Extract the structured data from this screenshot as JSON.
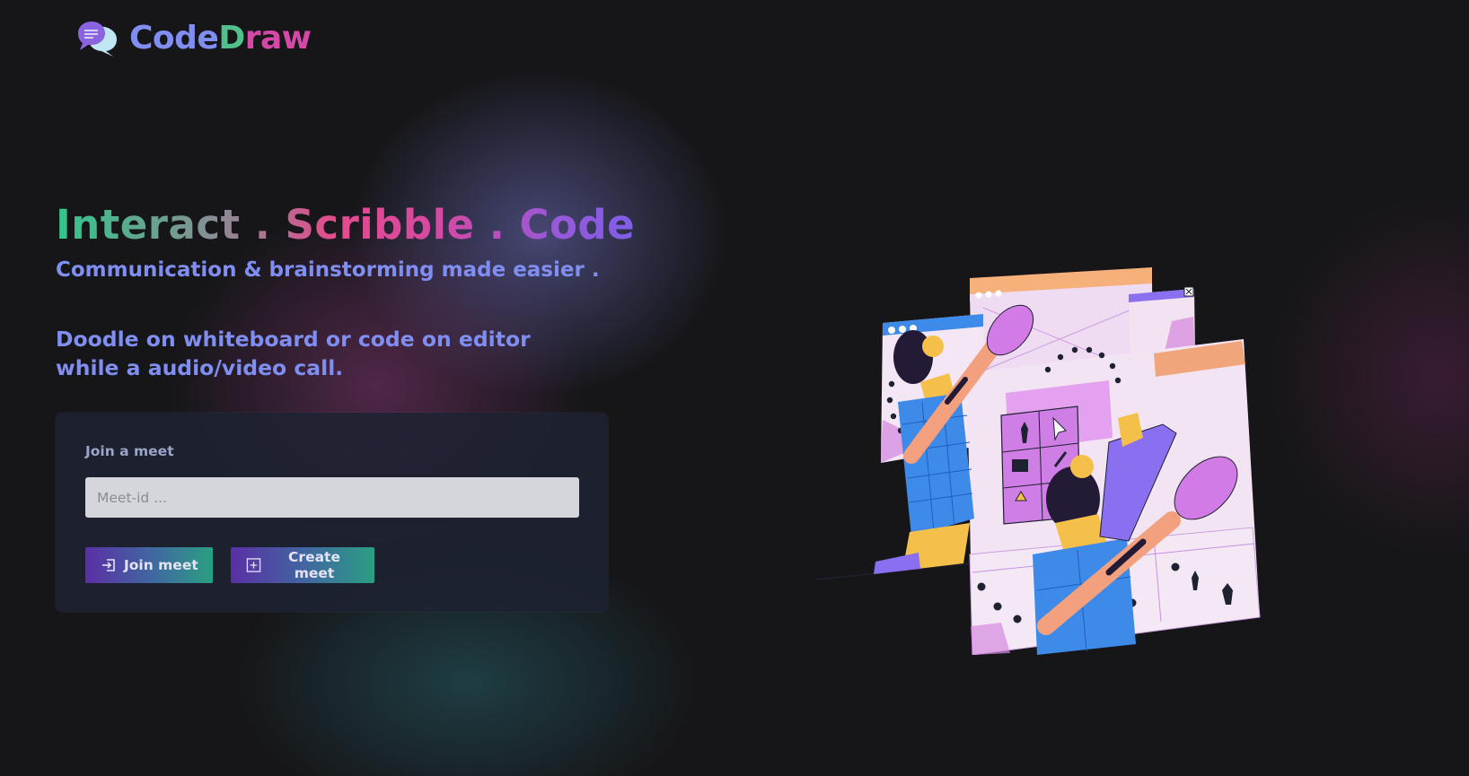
{
  "brand": {
    "logo_icon": "chat-bubbles-icon",
    "name_part1": "Code",
    "name_part2": "D",
    "name_part3": "raw"
  },
  "hero": {
    "title": "Interact . Scribble . Code",
    "subtitle": "Communication & brainstorming made easier .",
    "description": "Doodle on whiteboard or code on editor while a audio/video call."
  },
  "join_card": {
    "label": "Join a meet",
    "input_placeholder": "Meet-id ...",
    "input_value": "",
    "join_button_label": "Join meet",
    "join_button_icon": "enter-icon",
    "create_button_label": "Create meet",
    "create_button_icon": "plus-square-icon"
  },
  "colors": {
    "background": "#161619",
    "accent_blue": "#7f8ef0",
    "accent_green": "#52c08c",
    "accent_pink": "#d548a8",
    "card_bg": "#1e2232",
    "button_gradient_start": "#5a2fa6",
    "button_gradient_end": "#2a9f82"
  },
  "illustration": {
    "icon": "whiteboard-illustration"
  }
}
